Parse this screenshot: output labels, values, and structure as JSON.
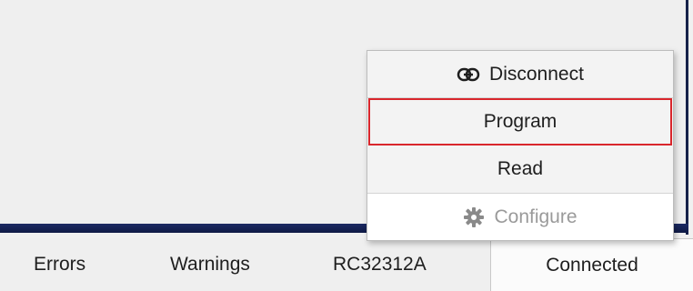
{
  "menu": {
    "items": [
      {
        "label": "Disconnect",
        "icon": "link-icon"
      },
      {
        "label": "Program"
      },
      {
        "label": "Read"
      },
      {
        "label": "Configure",
        "icon": "gear-icon",
        "disabled": true
      }
    ]
  },
  "statusbar": {
    "errors": "Errors",
    "warnings": "Warnings",
    "device": "RC32312A",
    "connection": "Connected"
  },
  "colors": {
    "accent_strip": "#16224a",
    "highlight_border": "#d9262c"
  }
}
